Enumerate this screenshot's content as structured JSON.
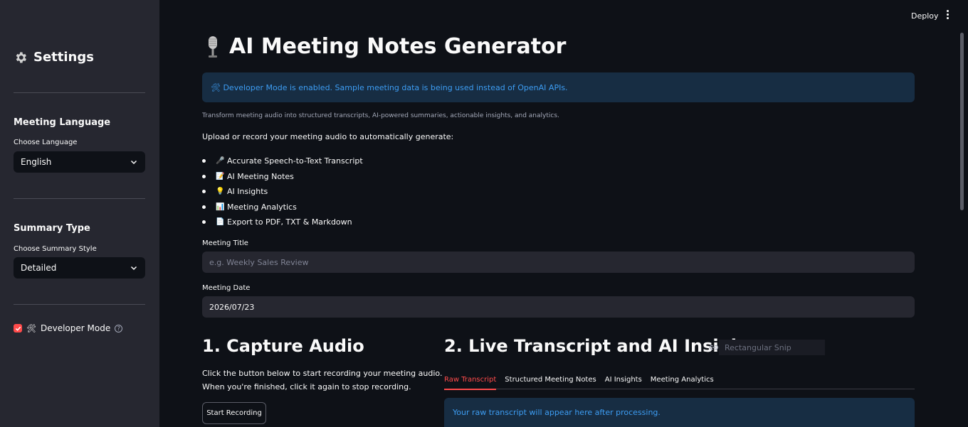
{
  "topbar": {
    "deploy_label": "Deploy"
  },
  "sidebar": {
    "title": "Settings",
    "language": {
      "heading": "Meeting Language",
      "label": "Choose Language",
      "value": "English"
    },
    "summary": {
      "heading": "Summary Type",
      "label": "Choose Summary Style",
      "value": "Detailed"
    },
    "developer_mode": {
      "label": "Developer Mode",
      "checked": true,
      "icon": "tools-icon"
    }
  },
  "main": {
    "title": "AI Meeting Notes Generator",
    "dev_alert": "🛠 Developer Mode is enabled. Sample meeting data is being used instead of OpenAI APIs.",
    "caption": "Transform meeting audio into structured transcripts, AI-powered summaries, actionable insights, and analytics.",
    "intro": "Upload or record your meeting audio to automatically generate:",
    "features": [
      {
        "icon": "🎤",
        "label": "Accurate Speech-to-Text Transcript"
      },
      {
        "icon": "📝",
        "label": "AI Meeting Notes"
      },
      {
        "icon": "💡",
        "label": "AI Insights"
      },
      {
        "icon": "📊",
        "label": "Meeting Analytics"
      },
      {
        "icon": "📄",
        "label": "Export to PDF, TXT & Markdown"
      }
    ],
    "meeting_title": {
      "label": "Meeting Title",
      "placeholder": "e.g. Weekly Sales Review",
      "value": ""
    },
    "meeting_date": {
      "label": "Meeting Date",
      "value": "2026/07/23"
    },
    "capture": {
      "heading": "1. Capture Audio",
      "line1": "Click the button below to start recording your meeting audio.",
      "line2": "When you're finished, click it again to stop recording.",
      "button": "Start Recording"
    },
    "transcript": {
      "heading": "2. Live Transcript and AI Insights",
      "snip_label": "Rectangular Snip",
      "tabs": [
        "Raw Transcript",
        "Structured Meeting Notes",
        "AI Insights",
        "Meeting Analytics"
      ],
      "active_tab": 0,
      "info": "Your raw transcript will appear here after processing."
    }
  },
  "colors": {
    "accent": "#ff4b4b",
    "info_bg": "#172d43",
    "info_text": "#3d9df3",
    "sidebar_bg": "#262730",
    "app_bg": "#0e1117"
  }
}
